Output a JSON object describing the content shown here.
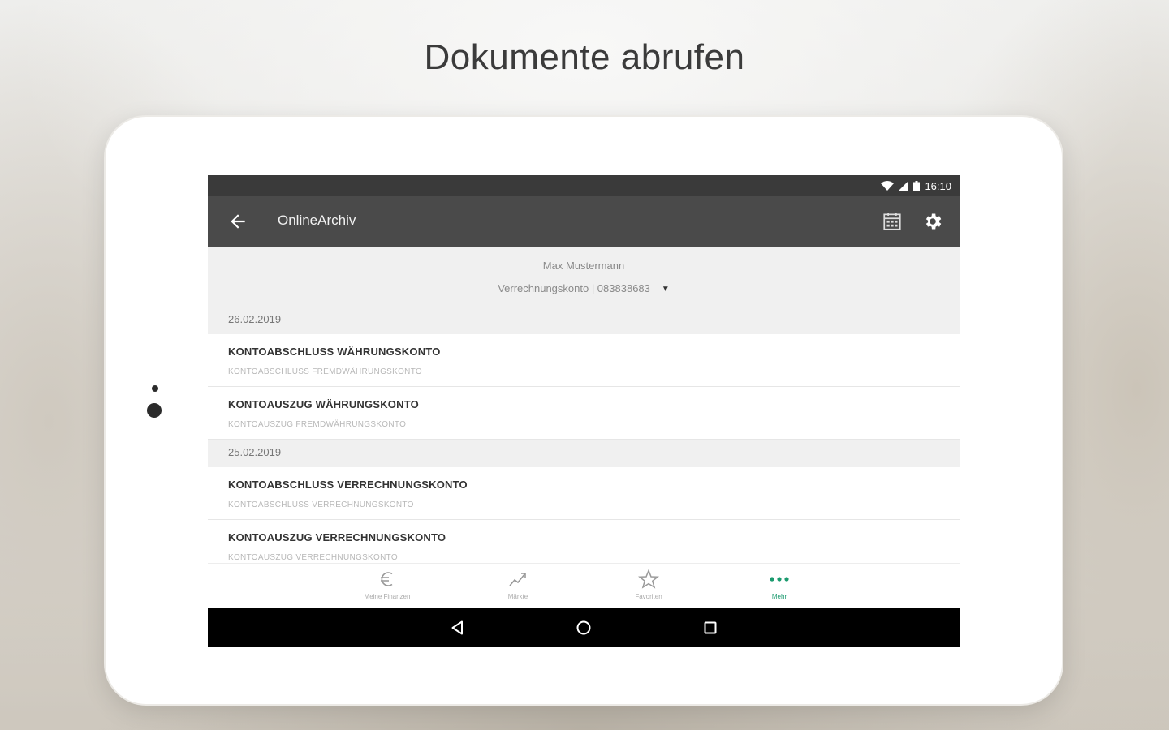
{
  "headline": "Dokumente abrufen",
  "status_bar": {
    "time": "16:10"
  },
  "app_bar": {
    "title": "OnlineArchiv"
  },
  "account": {
    "holder": "Max Mustermann",
    "selected_account": "Verrechnungskonto | 083838683"
  },
  "documents": {
    "groups": [
      {
        "date": "26.02.2019",
        "items": [
          {
            "title": "KONTOABSCHLUSS WÄHRUNGSKONTO",
            "subtitle": "KONTOABSCHLUSS FREMDWÄHRUNGSKONTO"
          },
          {
            "title": "KONTOAUSZUG WÄHRUNGSKONTO",
            "subtitle": "KONTOAUSZUG FREMDWÄHRUNGSKONTO"
          }
        ]
      },
      {
        "date": "25.02.2019",
        "items": [
          {
            "title": "KONTOABSCHLUSS VERRECHNUNGSKONTO",
            "subtitle": "KONTOABSCHLUSS VERRECHNUNGSKONTO"
          },
          {
            "title": "KONTOAUSZUG VERRECHNUNGSKONTO",
            "subtitle": "KONTOAUSZUG VERRECHNUNGSKONTO"
          }
        ]
      }
    ]
  },
  "bottom_nav": [
    {
      "label": "Meine Finanzen",
      "icon": "euro-icon"
    },
    {
      "label": "Märkte",
      "icon": "chart-icon"
    },
    {
      "label": "Favoriten",
      "icon": "star-icon"
    },
    {
      "label": "Mehr",
      "icon": "more-icon",
      "active": true
    }
  ],
  "colors": {
    "app_bar": "#4a4a4a",
    "accent": "#1a9a6e"
  }
}
